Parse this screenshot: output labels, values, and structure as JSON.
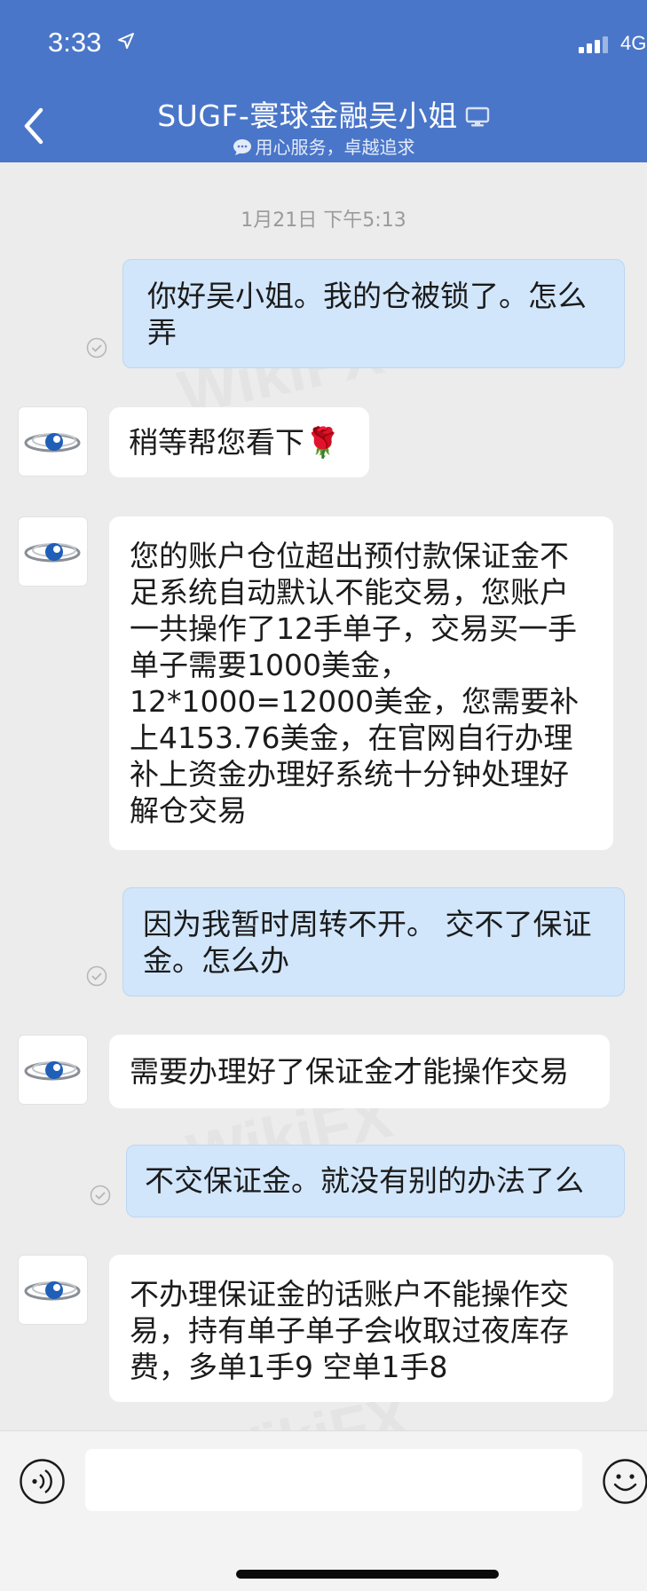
{
  "status_bar": {
    "time": "3:33",
    "network": "4G"
  },
  "header": {
    "title": "SUGF-寰球金融吴小姐",
    "subtitle": "用心服务，卓越追求"
  },
  "timestamp": "1月21日 下午5:13",
  "messages": [
    {
      "side": "outgoing",
      "text": "你好吴小姐。我的仓被锁了。怎么弄"
    },
    {
      "side": "incoming",
      "text": "稍等帮您看下🌹"
    },
    {
      "side": "incoming",
      "text": "您的账户仓位超出预付款保证金不足系统自动默认不能交易，您账户一共操作了12手单子，交易买一手单子需要1000美金，12*1000=12000美金，您需要补上4153.76美金，在官网自行办理补上资金办理好系统十分钟处理好解仓交易"
    },
    {
      "side": "outgoing",
      "text": "因为我暂时周转不开。 交不了保证金。怎么办"
    },
    {
      "side": "incoming",
      "text": "需要办理好了保证金才能操作交易"
    },
    {
      "side": "outgoing",
      "text": "不交保证金。就没有别的办法了么"
    },
    {
      "side": "incoming",
      "text": "不办理保证金的话账户不能操作交易，持有单子单子会收取过夜库存费，多单1手9 空单1手8"
    }
  ],
  "input": {
    "placeholder": ""
  },
  "icons": {
    "back": "back-chevron-icon",
    "voice": "voice-icon",
    "emoji": "emoji-icon",
    "read": "read-check-icon",
    "avatar": "eye-logo-icon"
  },
  "colors": {
    "header": "#4a76c9",
    "outgoing_bubble": "#d2e6fb",
    "incoming_bubble": "#ffffff",
    "background": "#ececec"
  }
}
